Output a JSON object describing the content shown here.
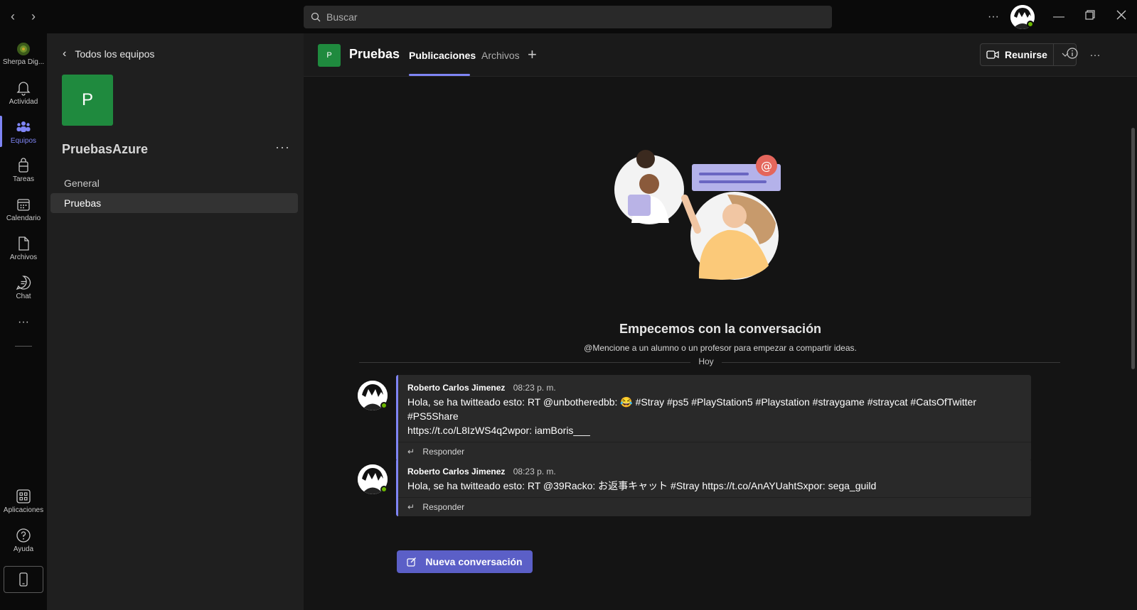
{
  "titlebar": {
    "search_placeholder": "Buscar",
    "icons": [
      "back-arrow-icon",
      "forward-arrow-icon",
      "search-icon",
      "more-icon",
      "minimize-icon",
      "restore-icon",
      "close-icon"
    ]
  },
  "rail": {
    "org_label": "Sherpa Dig...",
    "items": [
      {
        "label": "Actividad",
        "icon": "bell-icon"
      },
      {
        "label": "Equipos",
        "icon": "teams-icon",
        "active": true
      },
      {
        "label": "Tareas",
        "icon": "assignments-icon"
      },
      {
        "label": "Calendario",
        "icon": "calendar-icon"
      },
      {
        "label": "Archivos",
        "icon": "file-icon"
      },
      {
        "label": "Chat",
        "icon": "chat-icon"
      }
    ],
    "more": "···",
    "apps_label": "Aplicaciones",
    "help_label": "Ayuda",
    "accent": "#7f85f5"
  },
  "teampane": {
    "back_label": "Todos los equipos",
    "team_initial": "P",
    "team_name": "PruebasAzure",
    "more": "···",
    "channels": [
      {
        "label": "General",
        "active": false
      },
      {
        "label": "Pruebas",
        "active": true
      }
    ],
    "team_color": "#1f8a3e"
  },
  "main": {
    "channel_initial": "P",
    "channel_title": "Pruebas",
    "tabs": [
      {
        "label": "Publicaciones",
        "active": true
      },
      {
        "label": "Archivos",
        "active": false
      }
    ],
    "meet_label": "Reunirse",
    "welcome_title": "Empecemos con la conversación",
    "welcome_sub": "@Mencione a un alumno o un profesor para empezar a compartir ideas.",
    "divider_label": "Hoy",
    "messages": [
      {
        "author": "Roberto Carlos Jimenez",
        "time": "08:23 p. m.",
        "body_line1": "Hola, se ha twitteado esto: RT @unbotheredbb: 😂 #Stray #ps5 #PlayStation5 #Playstation #straygame #straycat #CatsOfTwitter #PS5Share",
        "body_line2": "https://t.co/L8IzWS4q2wpor: iamBoris___",
        "reply_label": "Responder"
      },
      {
        "author": "Roberto Carlos Jimenez",
        "time": "08:23 p. m.",
        "body_line1": "Hola, se ha twitteado esto: RT @39Racko: お返事キャット #Stray https://t.co/AnAYUahtSxpor: sega_guild",
        "reply_label": "Responder"
      }
    ],
    "new_conversation_label": "Nueva conversación",
    "button_color": "#5b5fc7"
  }
}
